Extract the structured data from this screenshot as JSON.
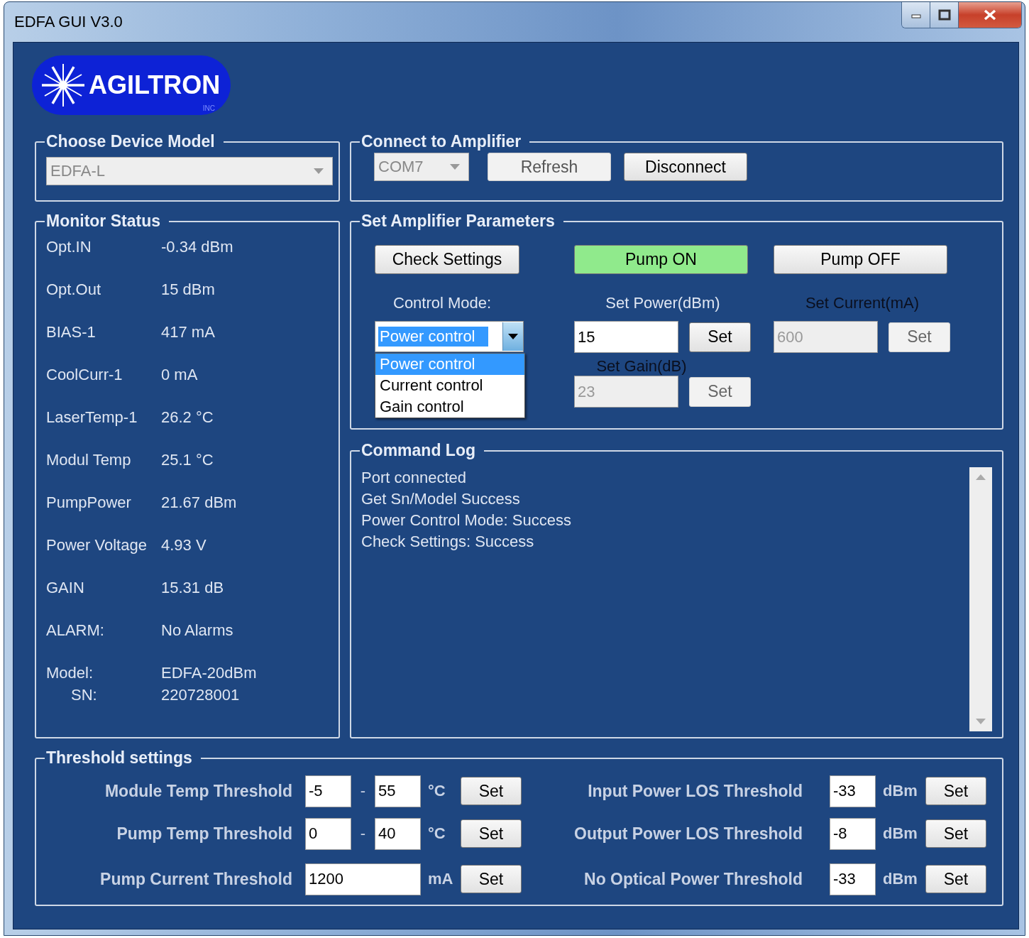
{
  "window": {
    "title": "EDFA GUI V3.0"
  },
  "logo": {
    "name": "AGILTRON",
    "suffix": "INC"
  },
  "device_model": {
    "title": "Choose Device Model",
    "value": "EDFA-L",
    "disabled": true
  },
  "connect": {
    "title": "Connect to Amplifier",
    "port": "COM7",
    "port_disabled": true,
    "buttons": [
      {
        "label": "Refresh",
        "disabled": true
      },
      {
        "label": "Disconnect",
        "disabled": false
      }
    ]
  },
  "monitor": {
    "title": "Monitor Status",
    "items": [
      {
        "label": "Opt.IN",
        "value": "-0.34 dBm"
      },
      {
        "label": "Opt.Out",
        "value": "15 dBm"
      },
      {
        "label": "BIAS-1",
        "value": "417 mA"
      },
      {
        "label": "CoolCurr-1",
        "value": "0 mA"
      },
      {
        "label": "LaserTemp-1",
        "value": "26.2 °C"
      },
      {
        "label": "Modul Temp",
        "value": "25.1 °C"
      },
      {
        "label": "PumpPower",
        "value": "21.67 dBm"
      },
      {
        "label": "Power Voltage",
        "value": "4.93 V"
      },
      {
        "label": "GAIN",
        "value": "15.31 dB"
      },
      {
        "label": "ALARM:",
        "value": "No Alarms"
      }
    ],
    "model_label": "Model:",
    "model": "EDFA-20dBm",
    "sn_label": "SN:",
    "sn": "220728001"
  },
  "parameters": {
    "title": "Set Amplifier Parameters",
    "buttons": [
      {
        "label": "Check Settings",
        "on": false
      },
      {
        "label": "Pump ON",
        "on": true
      },
      {
        "label": "Pump OFF",
        "on": false
      }
    ],
    "control_mode": {
      "label": "Control Mode:",
      "value": "Power control",
      "expanded": true,
      "options": [
        {
          "label": "Power control",
          "selected": true
        },
        {
          "label": "Current control",
          "selected": false
        },
        {
          "label": "Gain control",
          "selected": false
        }
      ]
    },
    "set_power": {
      "label": "Set Power(dBm)",
      "value": "15",
      "disabled": false,
      "button": "Set"
    },
    "set_current": {
      "label": "Set Current(mA)",
      "value": "600",
      "disabled": true,
      "button": "Set"
    },
    "set_gain": {
      "label": "Set Gain(dB)",
      "value": "23",
      "disabled": true,
      "button": "Set"
    }
  },
  "command_log": {
    "title": "Command Log",
    "lines": [
      "Port connected",
      "Get Sn/Model Success",
      "Power Control Mode: Success",
      "Check Settings: Success"
    ]
  },
  "thresholds": {
    "title": "Threshold settings",
    "left": [
      {
        "kind": "range",
        "label": "Module Temp Threshold",
        "min": "-5",
        "separator": "-",
        "max": "55",
        "unit": "°C",
        "button": "Set"
      },
      {
        "kind": "range",
        "label": "Pump Temp Threshold",
        "min": "0",
        "separator": "-",
        "max": "40",
        "unit": "°C",
        "button": "Set"
      },
      {
        "kind": "single",
        "label": "Pump Current Threshold",
        "value": "1200",
        "unit": "mA",
        "button": "Set"
      }
    ],
    "right": [
      {
        "label": "Input Power LOS Threshold",
        "value": "-33",
        "unit": "dBm",
        "button": "Set"
      },
      {
        "label": "Output Power LOS Threshold",
        "value": "-8",
        "unit": "dBm",
        "button": "Set"
      },
      {
        "label": "No Optical Power Threshold",
        "value": "-33",
        "unit": "dBm",
        "button": "Set"
      }
    ]
  }
}
